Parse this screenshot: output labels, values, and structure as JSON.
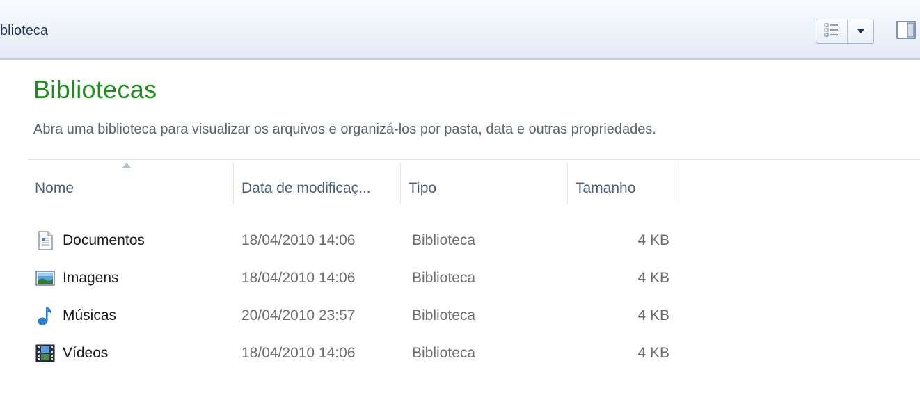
{
  "toolbar": {
    "location_label": "blioteca",
    "view_button_icon": "details-view-icon",
    "view_dropdown_icon": "chevron-down-icon",
    "preview_pane_icon": "preview-pane-icon"
  },
  "content": {
    "title": "Bibliotecas",
    "subtitle": "Abra uma biblioteca para visualizar os arquivos e organizá-los por pasta, data e outras propriedades."
  },
  "columns": {
    "name": "Nome",
    "date": "Data de modificaç...",
    "type": "Tipo",
    "size": "Tamanho",
    "sorted_by": "name",
    "sort_direction": "ascending"
  },
  "rows": [
    {
      "icon": "document-library-icon",
      "name": "Documentos",
      "date": "18/04/2010 14:06",
      "type": "Biblioteca",
      "size": "4 KB"
    },
    {
      "icon": "picture-library-icon",
      "name": "Imagens",
      "date": "18/04/2010 14:06",
      "type": "Biblioteca",
      "size": "4 KB"
    },
    {
      "icon": "music-library-icon",
      "name": "Músicas",
      "date": "20/04/2010 23:57",
      "type": "Biblioteca",
      "size": "4 KB"
    },
    {
      "icon": "video-library-icon",
      "name": "Vídeos",
      "date": "18/04/2010 14:06",
      "type": "Biblioteca",
      "size": "4 KB"
    }
  ],
  "colors": {
    "title": "#1e8c1e",
    "header_text": "#4c607a",
    "item_text": "#1b1b1b",
    "meta_text": "#6d6d6d",
    "toolbar_top": "#f9fbfe",
    "toolbar_bottom": "#e2eaf5"
  }
}
